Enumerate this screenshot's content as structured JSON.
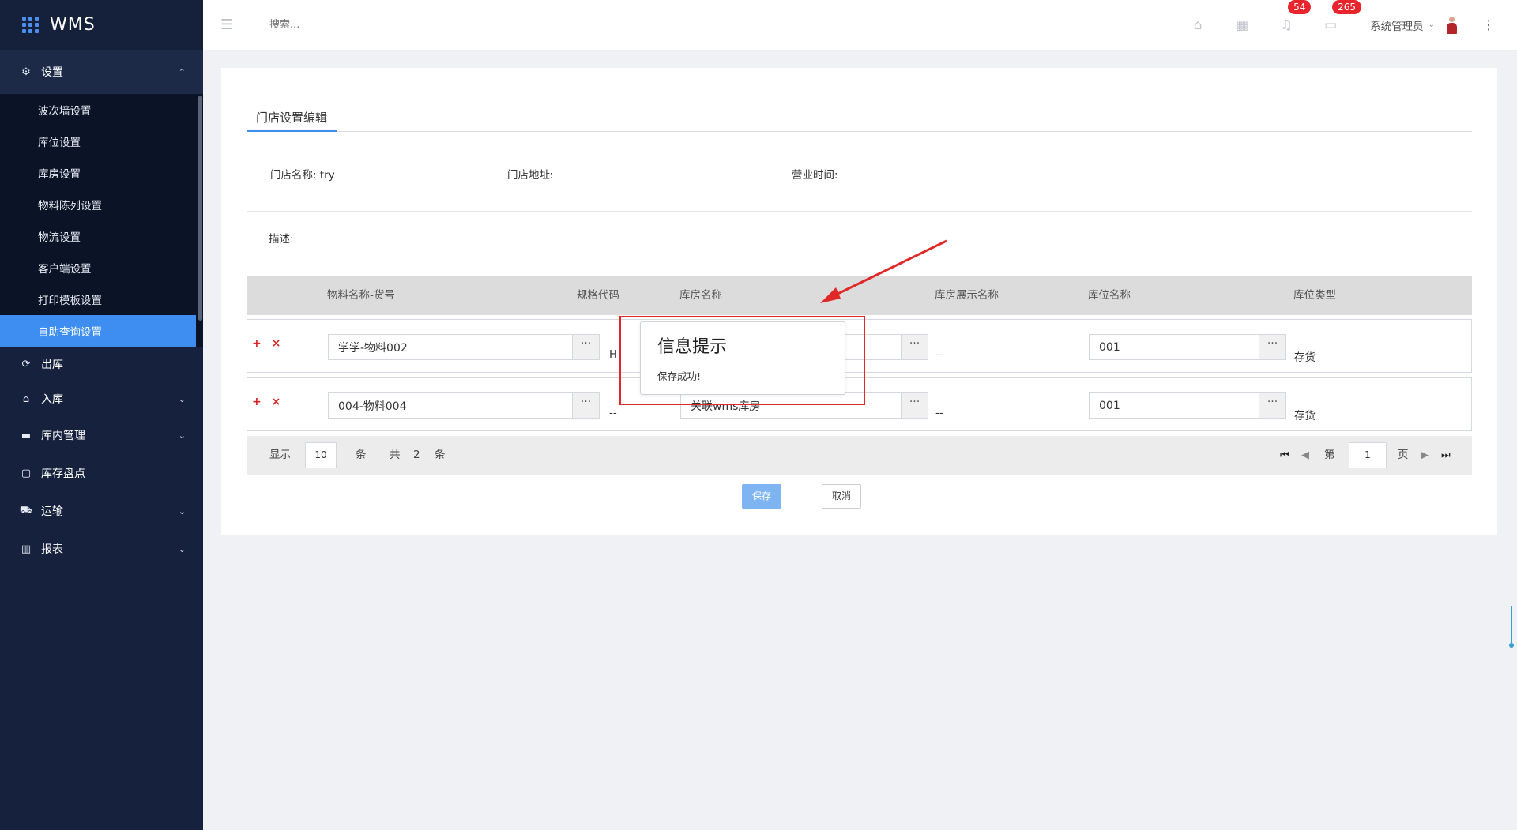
{
  "app": {
    "name": "WMS"
  },
  "sidebar": {
    "groups": [
      {
        "label": "设置",
        "icon": "gear-icon",
        "open": true,
        "items": [
          "波次墙设置",
          "库位设置",
          "库房设置",
          "物料陈列设置",
          "物流设置",
          "客户端设置",
          "打印模板设置",
          "自助查询设置"
        ],
        "active": "自助查询设置"
      },
      {
        "label": "出库",
        "icon": "outbound-icon"
      },
      {
        "label": "入库",
        "icon": "inbound-icon"
      },
      {
        "label": "库内管理",
        "icon": "warehouse-icon"
      },
      {
        "label": "库存盘点",
        "icon": "inventory-icon"
      },
      {
        "label": "运输",
        "icon": "truck-icon"
      },
      {
        "label": "报表",
        "icon": "chart-icon"
      }
    ]
  },
  "header": {
    "search_placeholder": "搜索...",
    "notifications_badge": "54",
    "messages_badge": "265",
    "user_name": "系统管理员"
  },
  "page": {
    "tab": "门店设置编辑",
    "store_name_label": "门店名称:",
    "store_name_value": "try",
    "store_address_label": "门店地址:",
    "business_hours_label": "营业时间:",
    "description_label": "描述:",
    "columns": [
      "物料名称-货号",
      "规格代码",
      "库房名称",
      "库房展示名称",
      "库位名称",
      "库位类型"
    ],
    "rows": [
      {
        "material": "学学-物料002",
        "spec": "H",
        "warehouse": "",
        "display_name": "--",
        "location": "001",
        "location_type": "存货"
      },
      {
        "material": "004-物料004",
        "spec": "--",
        "warehouse": "关联wms库房",
        "display_name": "--",
        "location": "001",
        "location_type": "存货"
      }
    ],
    "row_ops": "+ ×",
    "picker_dots": "···",
    "pager": {
      "show_label": "显示",
      "page_size": "10",
      "unit": "条",
      "total_label": "共",
      "total": "2",
      "total_unit": "条",
      "page_prefix": "第",
      "page": "1",
      "page_suffix": "页"
    },
    "save_label": "保存",
    "cancel_label": "取消"
  },
  "dialog": {
    "title": "信息提示",
    "message": "保存成功!"
  },
  "colors": {
    "sidebar_bg": "#16223d",
    "accent": "#3d8ef0",
    "badge": "#e8242c",
    "annotation_red": "#e02828"
  }
}
